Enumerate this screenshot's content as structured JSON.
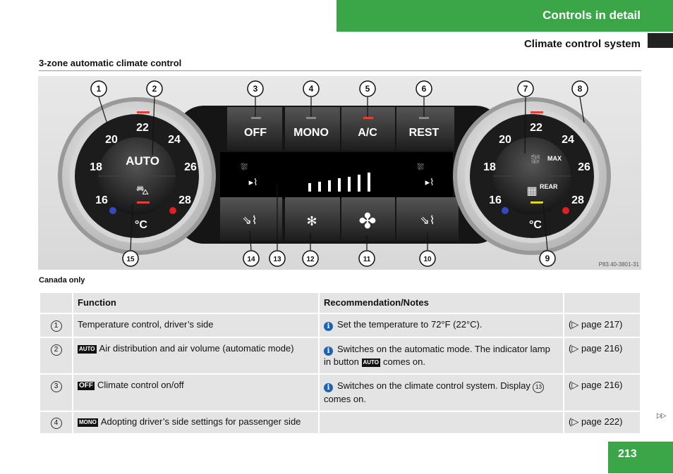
{
  "header": {
    "chapter": "Controls in detail",
    "section": "Climate control system"
  },
  "section_title": "3-zone automatic climate control",
  "figure": {
    "callouts": [
      "1",
      "2",
      "3",
      "4",
      "5",
      "6",
      "7",
      "8",
      "9",
      "10",
      "11",
      "12",
      "13",
      "14",
      "15"
    ],
    "buttons": {
      "off": "OFF",
      "mono": "MONO",
      "ac": "A/C",
      "rest": "REST",
      "auto": "AUTO",
      "max": "MAX",
      "rear": "REAR"
    },
    "left_dial": [
      "20",
      "22",
      "24",
      "18",
      "26",
      "16",
      "28"
    ],
    "right_dial": [
      "20",
      "22",
      "24",
      "18",
      "26",
      "16",
      "28"
    ],
    "unit": "°C",
    "code": "P83.40-3801-31"
  },
  "note": "Canada only",
  "table": {
    "headers": [
      "",
      "Function",
      "Recommendation/Notes",
      ""
    ],
    "rows": [
      {
        "num": "1",
        "badge": "",
        "function": "Temperature control, driver’s side",
        "note": "Set the temperature to 72°F (22°C).",
        "ref": "(▷ page 217)"
      },
      {
        "num": "2",
        "badge": "AUTO",
        "function": "Air distribution and air volume (automatic mode)",
        "note_a": "Switches on the automatic mode. The indicator lamp in button",
        "note_badge": "AUTO",
        "note_b": "comes on.",
        "ref": "(▷ page 216)"
      },
      {
        "num": "3",
        "badge": "OFF",
        "function": "Climate control on/off",
        "note_a": "Switches on the climate control system. Display",
        "note_ref": "13",
        "note_b": "comes on.",
        "ref": "(▷ page 216)"
      },
      {
        "num": "4",
        "badge": "MONO",
        "function": "Adopting driver’s side settings for passenger side",
        "note": "",
        "ref": "(▷ page 222)"
      }
    ]
  },
  "nav_arrow": "▷▷",
  "page_number": "213"
}
